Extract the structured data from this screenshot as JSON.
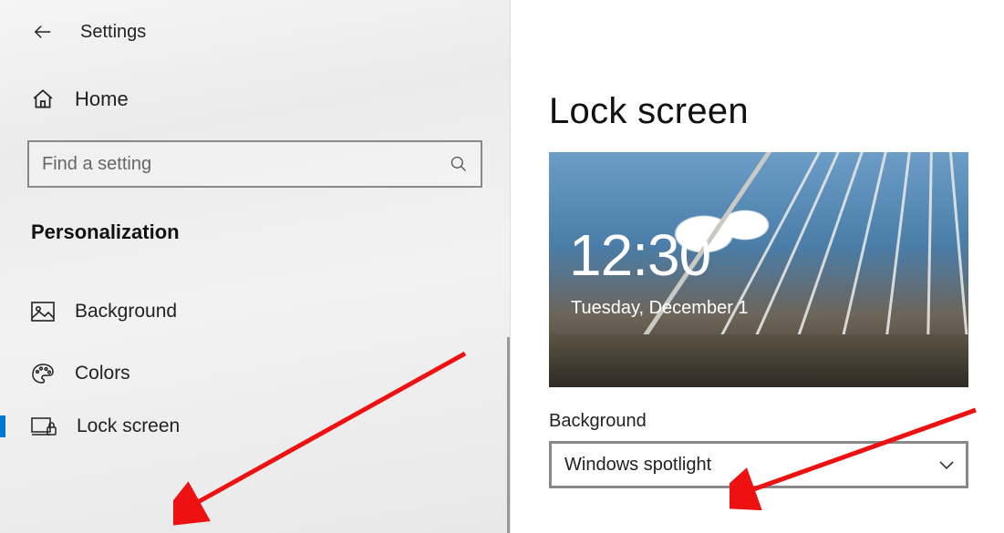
{
  "header": {
    "app_title": "Settings"
  },
  "sidebar": {
    "home_label": "Home",
    "search_placeholder": "Find a setting",
    "section_title": "Personalization",
    "items": [
      {
        "label": "Background"
      },
      {
        "label": "Colors"
      },
      {
        "label": "Lock screen"
      }
    ]
  },
  "main": {
    "page_title": "Lock screen",
    "preview_time": "12:30",
    "preview_date": "Tuesday, December 1",
    "background_label": "Background",
    "background_value": "Windows spotlight"
  }
}
